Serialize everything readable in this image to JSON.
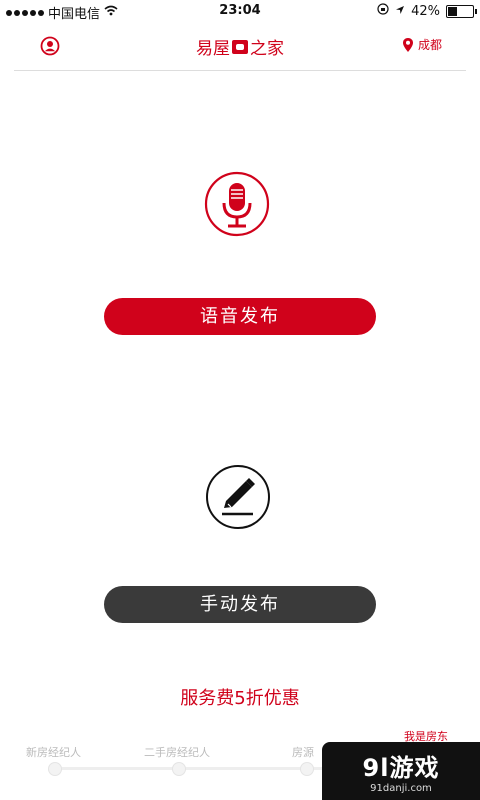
{
  "status": {
    "carrier": "中国电信",
    "time": "23:04",
    "battery": "42%",
    "battery_level": 0.42
  },
  "header": {
    "title_left": "易屋",
    "title_right": "之家",
    "city": "成都"
  },
  "actions": {
    "voice_label": "语音发布",
    "manual_label": "手动发布"
  },
  "promo": "服务费5折优惠",
  "landlord_label": "我是房东",
  "slider": {
    "labels": [
      "新房经纪人",
      "二手房经纪人",
      "房源"
    ]
  },
  "watermark": {
    "big": "9l游戏",
    "small": "91danji.com"
  },
  "colors": {
    "accent": "#d0021b",
    "dark_button": "#3a3a3a"
  }
}
